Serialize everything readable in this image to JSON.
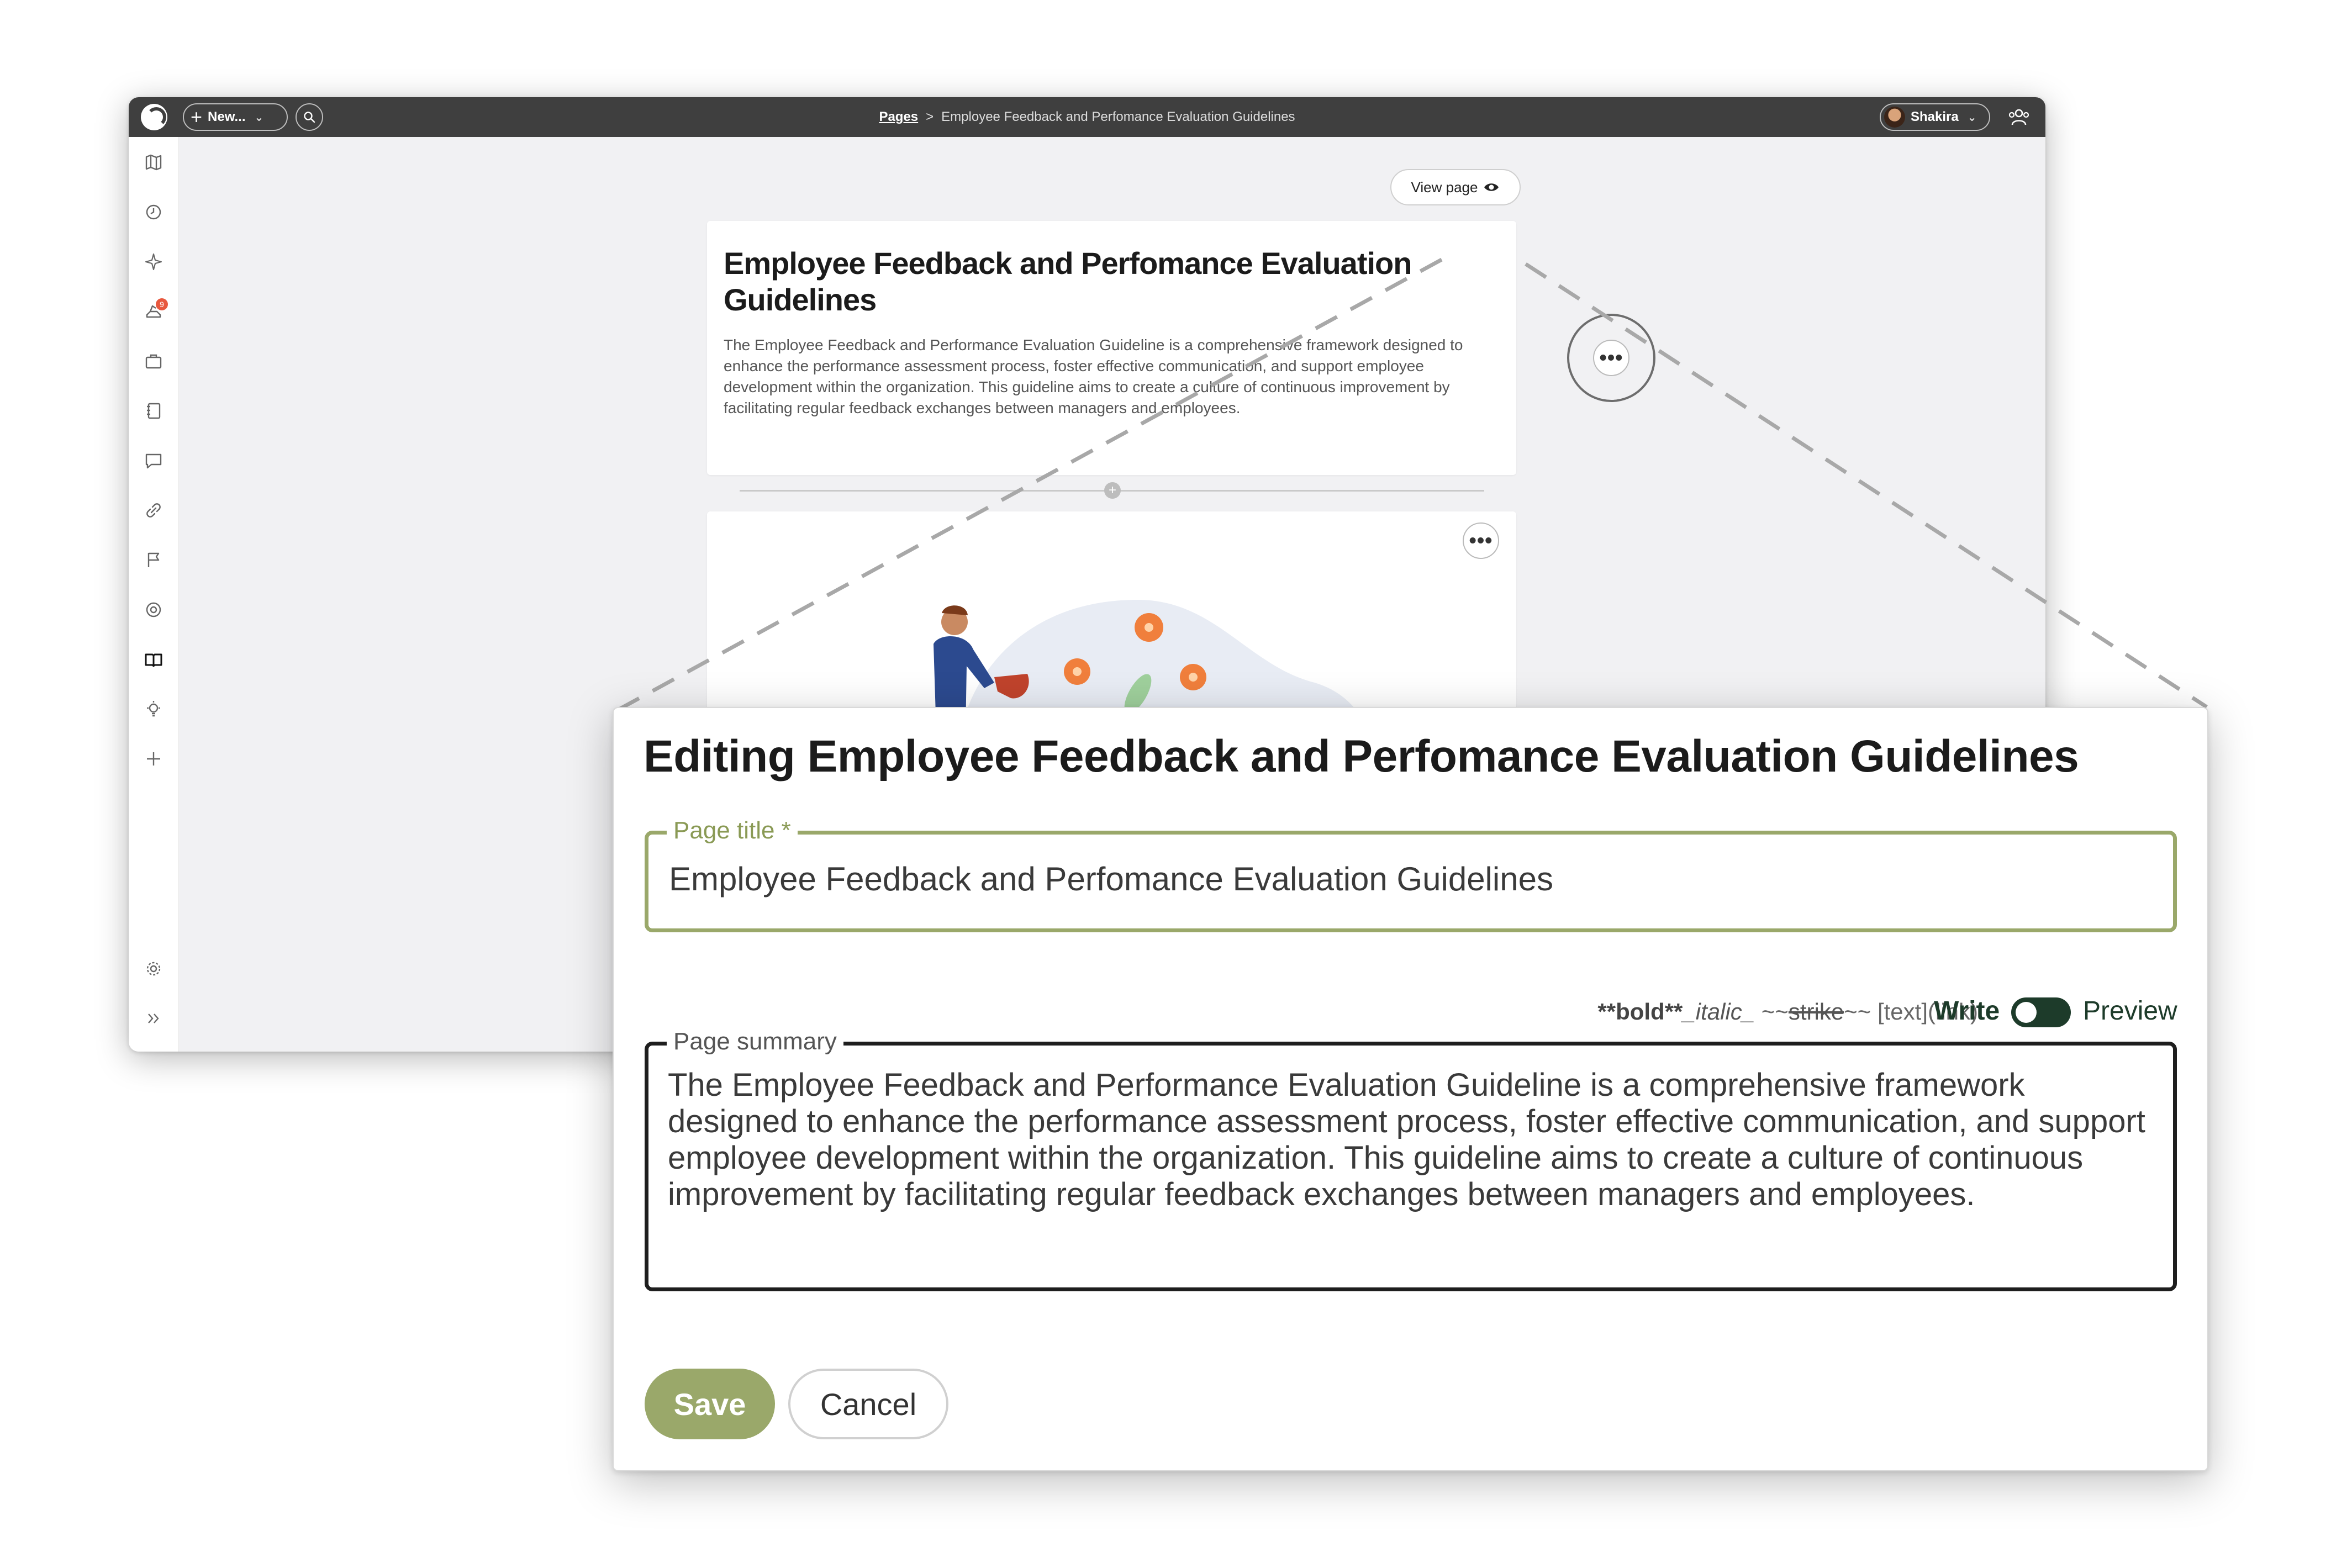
{
  "app": {
    "new_label": "New...",
    "breadcrumb": {
      "root": "Pages",
      "separator": ">",
      "current": "Employee Feedback and Perfomance Evaluation Guidelines"
    },
    "user_name": "Shakira",
    "notification_count": "9",
    "view_page_label": "View page",
    "card": {
      "title": "Employee Feedback and Perfomance Evaluation Guidelines",
      "summary": "The Employee Feedback and Performance Evaluation Guideline is a comprehensive framework designed to enhance the performance assessment process, foster effective communication, and support employee development within the organization. This guideline aims to create a culture of continuous improvement by facilitating regular feedback exchanges between managers and employees."
    },
    "more_label": "•••",
    "add_block_label": "+"
  },
  "modal": {
    "heading": "Editing Employee Feedback and Perfomance Evaluation Guidelines",
    "title_label": "Page title *",
    "title_value": "Employee Feedback and Perfomance Evaluation Guidelines",
    "markdown_hint": {
      "bold": "**bold**",
      "italic": "_italic_",
      "strike_prefix": "~~",
      "strike": "strike",
      "strike_suffix": "~~",
      "link": "[text](link)"
    },
    "write_label": "Write",
    "preview_label": "Preview",
    "summary_label": "Page summary",
    "summary_value": "The Employee Feedback and Performance Evaluation Guideline is a comprehensive framework designed to enhance the performance assessment process, foster effective communication, and support employee development within the organization. This guideline aims to create a culture of continuous improvement by facilitating regular feedback exchanges between managers and employees.",
    "save_label": "Save",
    "cancel_label": "Cancel"
  },
  "colors": {
    "topbar": "#3f3f3f",
    "accent_olive": "#9aa86a",
    "toggle_dark_green": "#1d3b2a",
    "badge": "#e8583e"
  }
}
